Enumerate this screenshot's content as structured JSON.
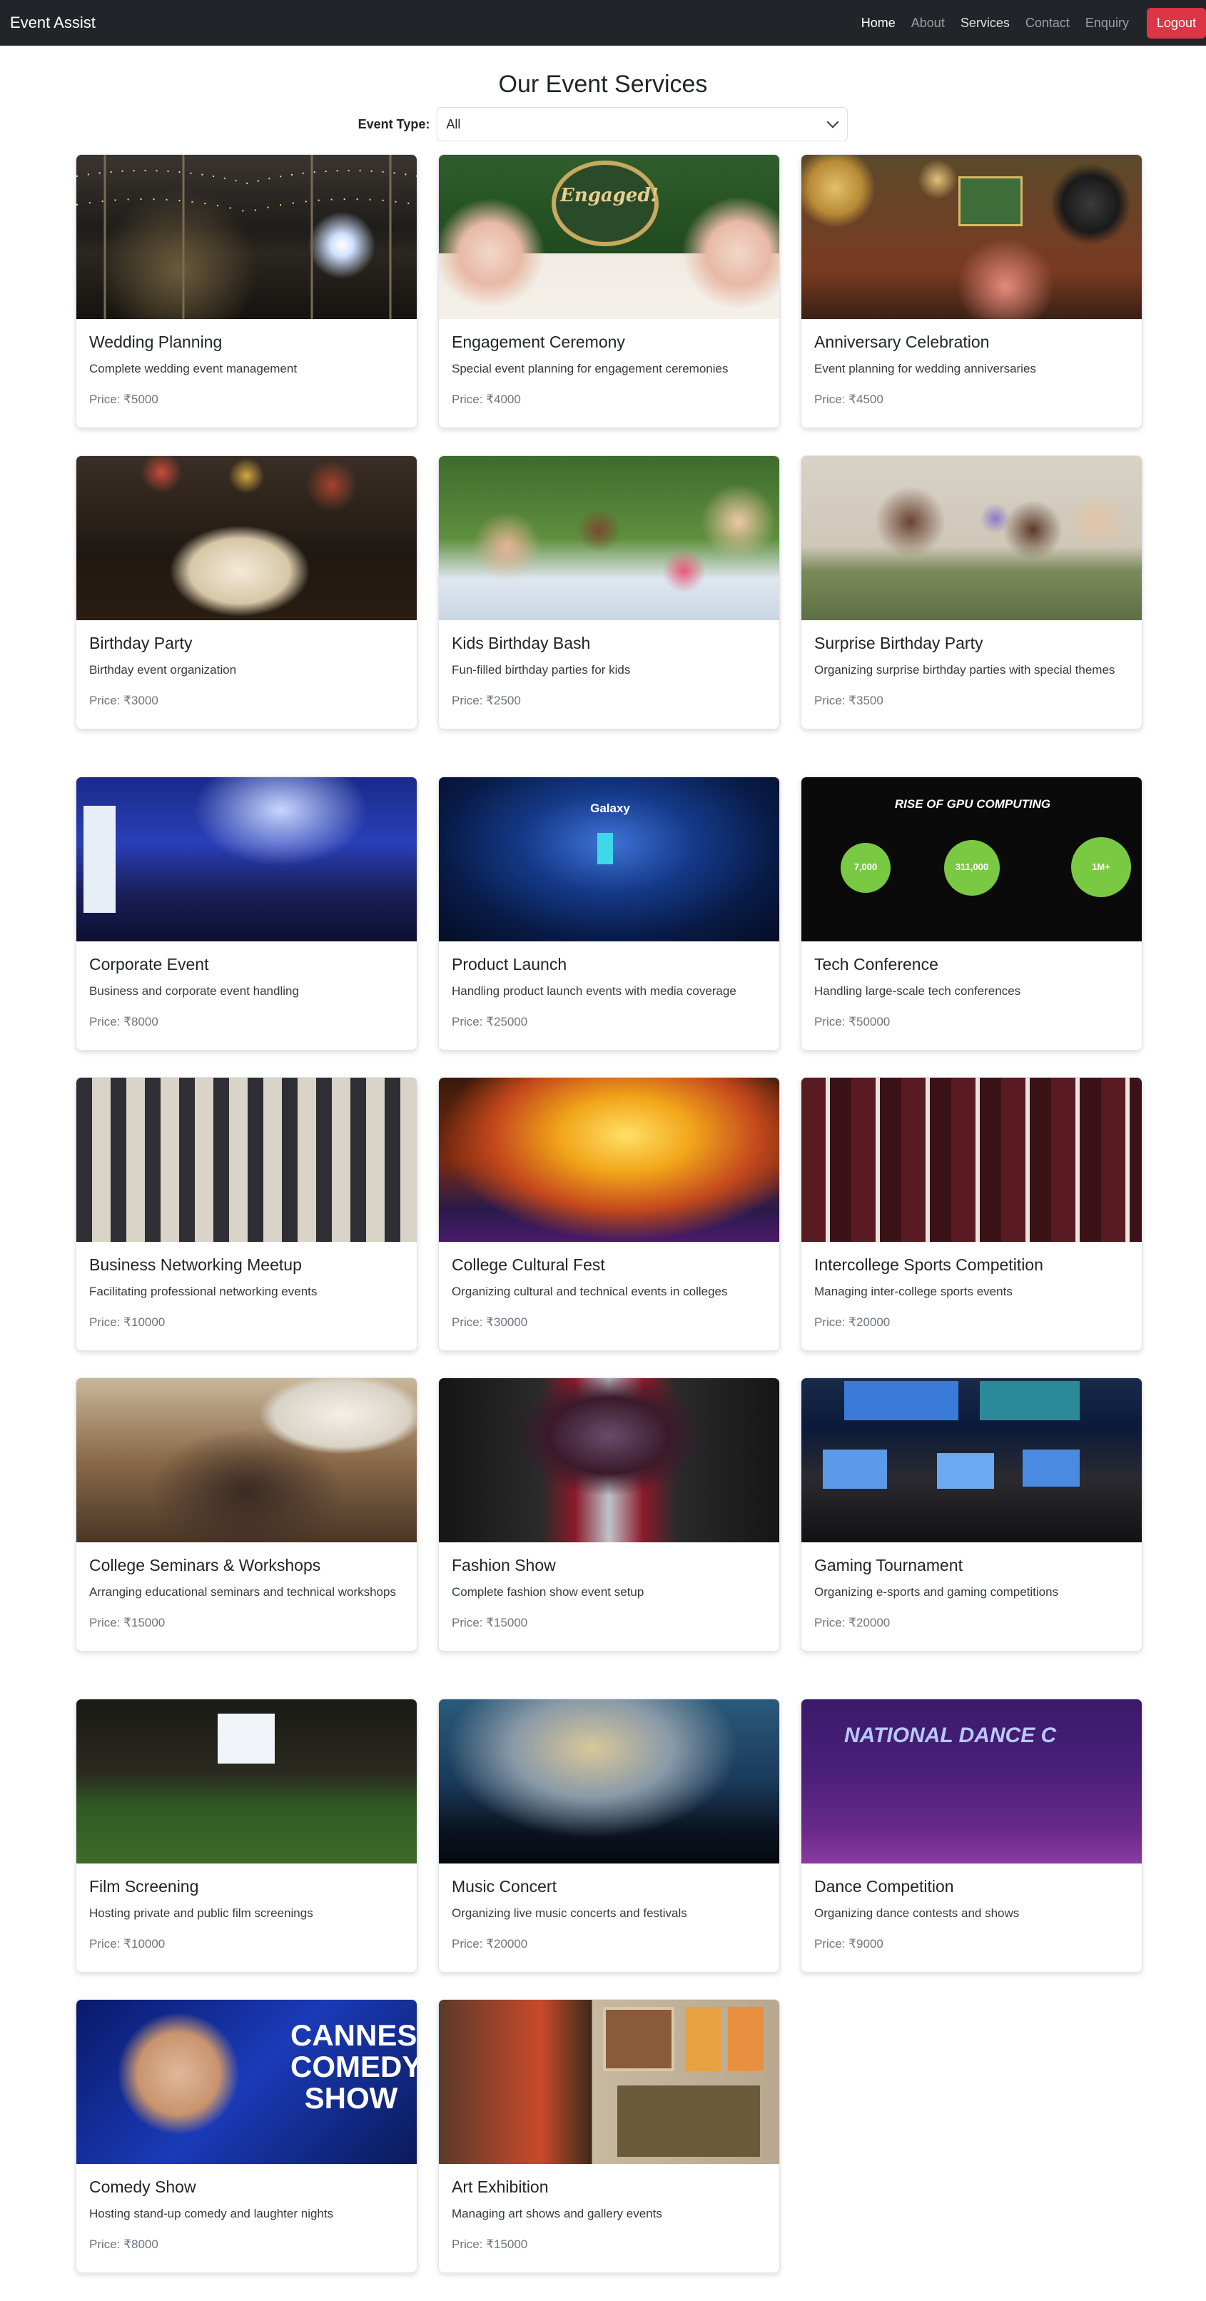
{
  "navbar": {
    "brand": "Event Assist",
    "links": [
      "Home",
      "About",
      "Services",
      "Contact",
      "Enquiry"
    ],
    "logout": "Logout"
  },
  "page": {
    "title": "Our Event Services",
    "filter_label": "Event Type:",
    "filter_value": "All"
  },
  "services": [
    {
      "title": "Wedding Planning",
      "desc": "Complete wedding event management",
      "price": "Price: ₹5000"
    },
    {
      "title": "Engagement Ceremony",
      "desc": "Special event planning for engagement ceremonies",
      "price": "Price: ₹4000"
    },
    {
      "title": "Anniversary Celebration",
      "desc": "Event planning for wedding anniversaries",
      "price": "Price: ₹4500"
    },
    {
      "title": "Birthday Party",
      "desc": "Birthday event organization",
      "price": "Price: ₹3000"
    },
    {
      "title": "Kids Birthday Bash",
      "desc": "Fun-filled birthday parties for kids",
      "price": "Price: ₹2500"
    },
    {
      "title": "Surprise Birthday Party",
      "desc": "Organizing surprise birthday parties with special themes",
      "price": "Price: ₹3500"
    },
    {
      "title": "Corporate Event",
      "desc": "Business and corporate event handling",
      "price": "Price: ₹8000"
    },
    {
      "title": "Product Launch",
      "desc": "Handling product launch events with media coverage",
      "price": "Price: ₹25000"
    },
    {
      "title": "Tech Conference",
      "desc": "Handling large-scale tech conferences",
      "price": "Price: ₹50000"
    },
    {
      "title": "Business Networking Meetup",
      "desc": "Facilitating professional networking events",
      "price": "Price: ₹10000"
    },
    {
      "title": "College Cultural Fest",
      "desc": "Organizing cultural and technical events in colleges",
      "price": "Price: ₹30000"
    },
    {
      "title": "Intercollege Sports Competition",
      "desc": "Managing inter-college sports events",
      "price": "Price: ₹20000"
    },
    {
      "title": "College Seminars & Workshops",
      "desc": "Arranging educational seminars and technical workshops",
      "price": "Price: ₹15000"
    },
    {
      "title": "Fashion Show",
      "desc": "Complete fashion show event setup",
      "price": "Price: ₹15000"
    },
    {
      "title": "Gaming Tournament",
      "desc": "Organizing e-sports and gaming competitions",
      "price": "Price: ₹20000"
    },
    {
      "title": "Film Screening",
      "desc": "Hosting private and public film screenings",
      "price": "Price: ₹10000"
    },
    {
      "title": "Music Concert",
      "desc": "Organizing live music concerts and festivals",
      "price": "Price: ₹20000"
    },
    {
      "title": "Dance Competition",
      "desc": "Organizing dance contests and shows",
      "price": "Price: ₹9000"
    },
    {
      "title": "Comedy Show",
      "desc": "Hosting stand-up comedy and laughter nights",
      "price": "Price: ₹8000"
    },
    {
      "title": "Art Exhibition",
      "desc": "Managing art shows and gallery events",
      "price": "Price: ₹15000"
    }
  ],
  "image_text": {
    "engaged": "Engaged!",
    "gpu_title": "RISE OF GPU COMPUTING",
    "gpu_a": "7,000",
    "gpu_b": "311,000",
    "gpu_c": "1M+",
    "galaxy": "Galaxy",
    "dance_banner": "NATIONAL DANCE C",
    "comedy": "CANNES COMEDY SHOW"
  }
}
